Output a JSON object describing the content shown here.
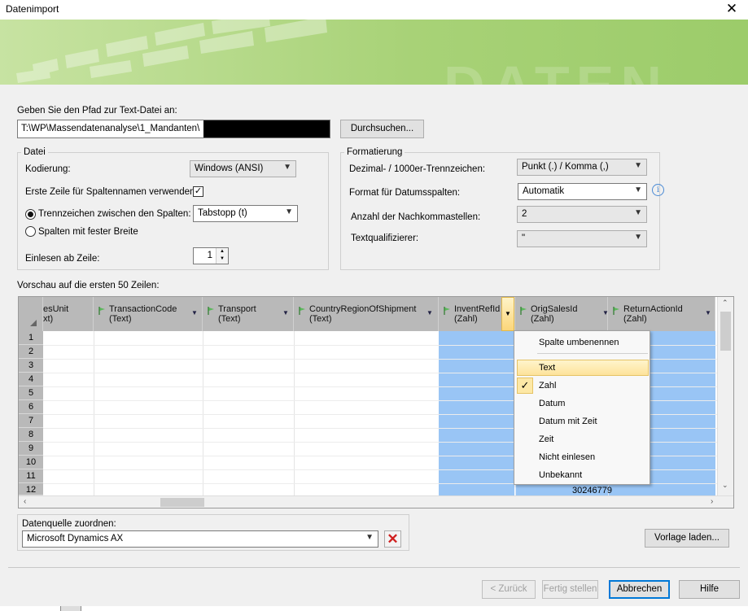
{
  "window": {
    "title": "Datenimport",
    "close_glyph": "✕"
  },
  "banner": {
    "watermark": "DATEN"
  },
  "path": {
    "label": "Geben Sie den Pfad zur Text-Datei an:",
    "value": "T:\\WP\\Massendatenanalyse\\1_Mandanten\\",
    "browse_label": "Durchsuchen..."
  },
  "datei": {
    "legend": "Datei",
    "encoding_label": "Kodierung:",
    "encoding_value": "Windows (ANSI)",
    "first_row_label": "Erste Zeile für Spaltennamen verwenden:",
    "first_row_checked": true,
    "delimiter_label": "Trennzeichen zwischen den Spalten:",
    "delimiter_value": "Tabstopp (t)",
    "fixed_width_label": "Spalten mit fester Breite",
    "start_row_label": "Einlesen ab Zeile:",
    "start_row_value": "1"
  },
  "format": {
    "legend": "Formatierung",
    "decimal_label": "Dezimal- / 1000er-Trennzeichen:",
    "decimal_value": "Punkt (.) / Komma (,)",
    "date_label": "Format für Datumsspalten:",
    "date_value": "Automatik",
    "decimals_label": "Anzahl der Nachkommastellen:",
    "decimals_value": "2",
    "qualifier_label": "Textqualifizierer:",
    "qualifier_value": "\""
  },
  "preview": {
    "label": "Vorschau auf die ersten 50 Zeilen:",
    "columns": [
      {
        "name": "esUnit",
        "type": "xt)"
      },
      {
        "name": "TransactionCode",
        "type": "(Text)"
      },
      {
        "name": "Transport",
        "type": "(Text)"
      },
      {
        "name": "CountryRegionOfShipment",
        "type": "(Text)"
      },
      {
        "name": "InventRefId",
        "type": "(Zahl)"
      },
      {
        "name": "OrigSalesId",
        "type": "(Zahl)"
      },
      {
        "name": "ReturnActionId",
        "type": "(Zahl)"
      }
    ],
    "row_numbers": [
      "1",
      "2",
      "3",
      "4",
      "5",
      "6",
      "7",
      "8",
      "9",
      "10",
      "11",
      "12"
    ],
    "visible_value": "30246779"
  },
  "context_menu": {
    "items": [
      "Spalte umbenennen",
      "Text",
      "Zahl",
      "Datum",
      "Datum mit Zeit",
      "Zeit",
      "Nicht einlesen",
      "Unbekannt"
    ],
    "checked": "Zahl",
    "hovered": "Text"
  },
  "datasource": {
    "label": "Datenquelle zuordnen:",
    "value": "Microsoft Dynamics AX"
  },
  "buttons": {
    "load_template": "Vorlage laden...",
    "back": "< Zurück",
    "finish": "Fertig stellen",
    "cancel": "Abbrechen",
    "help": "Hilfe"
  },
  "colors": {
    "accent_green": "#a8d277",
    "selected_column": "#99c5f5",
    "header_gray": "#b9b9b9",
    "focus_blue": "#0078d7"
  }
}
